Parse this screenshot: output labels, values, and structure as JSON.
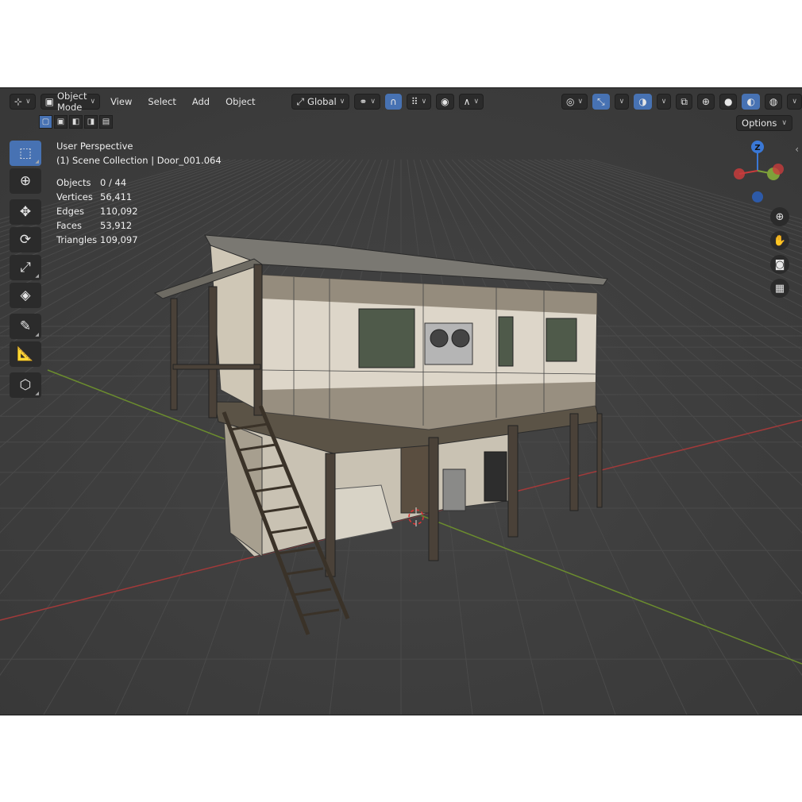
{
  "header": {
    "editor_type_icon": "axis-icon",
    "mode_label": "Object Mode",
    "menus": [
      "View",
      "Select",
      "Add",
      "Object"
    ],
    "orientation_label": "Global",
    "options_label": "Options"
  },
  "overlay": {
    "perspective": "User Perspective",
    "collection": "(1) Scene Collection | Door_001.064"
  },
  "stats": {
    "objects_label": "Objects",
    "objects_value": "0 / 44",
    "vertices_label": "Vertices",
    "vertices_value": "56,411",
    "edges_label": "Edges",
    "edges_value": "110,092",
    "faces_label": "Faces",
    "faces_value": "53,912",
    "triangles_label": "Triangles",
    "triangles_value": "109,097"
  },
  "gizmo": {
    "z_label": "Z"
  },
  "colors": {
    "accent": "#4772b3",
    "viewport_bg": "#3d3d3d",
    "x_axis": "#c83c3c",
    "y_axis": "#7ea03a",
    "z_axis": "#3a78d6"
  }
}
